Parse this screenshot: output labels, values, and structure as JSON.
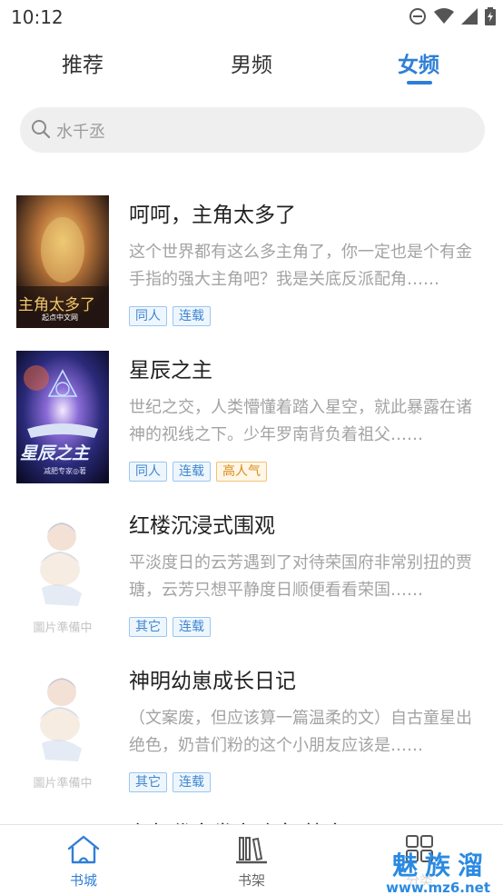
{
  "status_bar": {
    "time": "10:12"
  },
  "tabs": [
    {
      "label": "推荐",
      "active": false
    },
    {
      "label": "男频",
      "active": false
    },
    {
      "label": "女频",
      "active": true
    }
  ],
  "search": {
    "placeholder": "水千丞"
  },
  "books": [
    {
      "title": "呵呵，主角太多了",
      "description": "这个世界都有这么多主角了，你一定也是个有金手指的强大主角吧？我是关底反派配角……",
      "tags": [
        "同人",
        "连载"
      ],
      "cover_text": "主角太多了",
      "cover_publisher": "起点中文网"
    },
    {
      "title": "星辰之主",
      "description": "世纪之交，人类懵懂着踏入星空，就此暴露在诸神的视线之下。少年罗南背负着祖父……",
      "tags": [
        "同人",
        "连载",
        "高人气"
      ],
      "cover_text": "星辰之主",
      "cover_publisher": "减肥专家◎著"
    },
    {
      "title": "红楼沉浸式围观",
      "description": "平淡度日的云芳遇到了对待荣国府非常别扭的贾瑭，云芳只想平静度日顺便看看荣国……",
      "tags": [
        "其它",
        "连载"
      ],
      "cover_caption": "圖片準備中"
    },
    {
      "title": "神明幼崽成长日记",
      "description": "（文案废，但应该算一篇温柔的文）自古童星出绝色，奶昔们粉的这个小朋友应该是……",
      "tags": [
        "其它",
        "连载"
      ],
      "cover_caption": "圖片準備中"
    }
  ],
  "partial_book_title": "在年代文发家致富[快穿]",
  "bottom_nav": [
    {
      "label": "书城",
      "icon": "house-icon",
      "active": true
    },
    {
      "label": "书架",
      "icon": "bookshelf-icon",
      "active": false
    },
    {
      "label": "分类",
      "icon": "grid-icon",
      "active": false
    }
  ],
  "watermark": {
    "title": "魅族溜",
    "url": "www.mz6.net"
  },
  "colors": {
    "accent": "#2f7fd6",
    "tag_blue": "#3f86d0",
    "tag_orange": "#d98b17"
  }
}
